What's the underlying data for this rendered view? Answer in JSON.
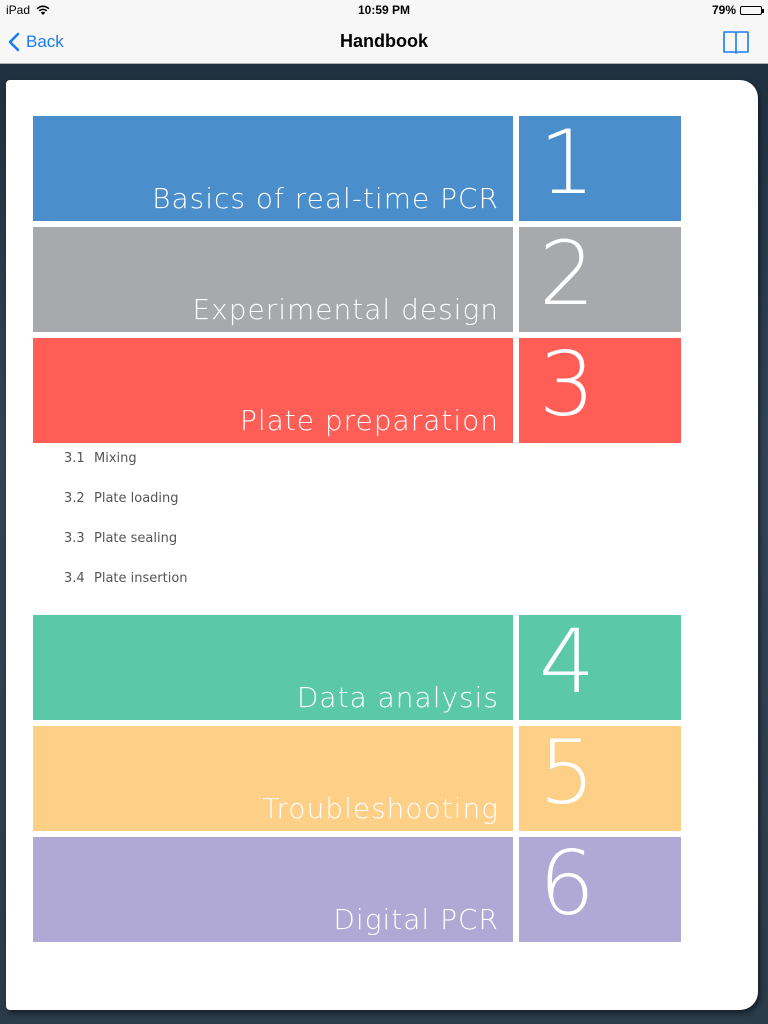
{
  "status_bar": {
    "device": "iPad",
    "time": "10:59 PM",
    "battery": "79%",
    "battery_level": 0.79
  },
  "nav": {
    "back_label": "Back",
    "title": "Handbook",
    "book_icon": "book-icon"
  },
  "chapters": [
    {
      "number": "1",
      "title": "Basics of real-time PCR",
      "color": "#4a8ecc"
    },
    {
      "number": "2",
      "title": "Experimental design",
      "color": "#a7a9ac"
    },
    {
      "number": "3",
      "title": "Plate preparation",
      "color": "#ff5e57"
    },
    {
      "number": "4",
      "title": "Data analysis",
      "color": "#5bc9a8"
    },
    {
      "number": "5",
      "title": "Troubleshooting",
      "color": "#fecf86"
    },
    {
      "number": "6",
      "title": "Digital PCR",
      "color": "#b1a9d5"
    }
  ],
  "subsections": [
    {
      "number": "3.1",
      "title": "Mixing"
    },
    {
      "number": "3.2",
      "title": "Plate loading"
    },
    {
      "number": "3.3",
      "title": "Plate sealing"
    },
    {
      "number": "3.4",
      "title": "Plate insertion"
    }
  ]
}
